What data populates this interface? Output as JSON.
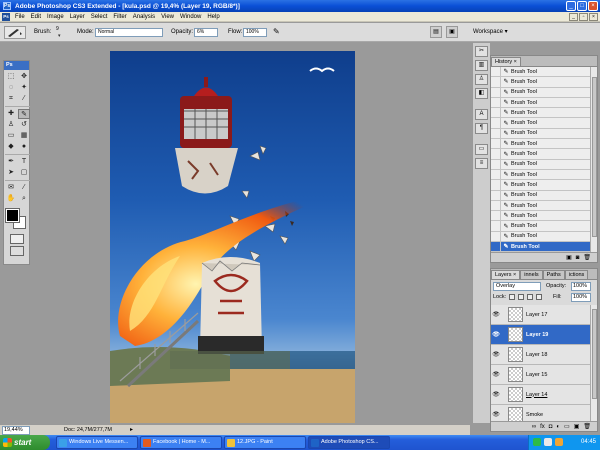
{
  "window": {
    "title": "Adobe Photoshop CS3 Extended - [kula.psd @ 19,4% (Layer 19, RGB/8*)]",
    "app_icon": "Ps"
  },
  "menu": {
    "items": [
      "File",
      "Edit",
      "Image",
      "Layer",
      "Select",
      "Filter",
      "Analysis",
      "View",
      "Window",
      "Help"
    ]
  },
  "options": {
    "brush_label": "Brush:",
    "brush_size": "9",
    "mode_label": "Mode:",
    "mode_value": "Normal",
    "opacity_label": "Opacity:",
    "opacity_value": "6%",
    "flow_label": "Flow:",
    "flow_value": "100%",
    "workspace_label": "Workspace"
  },
  "toolbox": {
    "header": "Ps"
  },
  "status": {
    "zoom": "19,44%",
    "doc": "Doc: 24,7M/277,7M"
  },
  "history": {
    "tabs": [
      "History"
    ],
    "items": [
      "Brush Tool",
      "Brush Tool",
      "Brush Tool",
      "Brush Tool",
      "Brush Tool",
      "Brush Tool",
      "Brush Tool",
      "Brush Tool",
      "Brush Tool",
      "Brush Tool",
      "Brush Tool",
      "Brush Tool",
      "Brush Tool",
      "Brush Tool",
      "Brush Tool",
      "Brush Tool",
      "Brush Tool",
      "Brush Tool"
    ],
    "selected_index": 17
  },
  "layers": {
    "tabs": [
      "Layers",
      "innels",
      "Paths",
      "ictions"
    ],
    "blend_mode": "Overlay",
    "opacity_label": "Opacity:",
    "opacity_value": "100%",
    "lock_label": "Lock:",
    "fill_label": "Fill:",
    "fill_value": "100%",
    "items": [
      {
        "name": "Layer 17"
      },
      {
        "name": "Layer 19"
      },
      {
        "name": "Layer 18"
      },
      {
        "name": "Layer 15"
      },
      {
        "name": "Layer 14"
      },
      {
        "name": "Smoke"
      }
    ],
    "selected_index": 1
  },
  "taskbar": {
    "start_label": "start",
    "items": [
      {
        "label": "Windows Live Messen...",
        "icon_color": "#3aa0e8"
      },
      {
        "label": "Facebook | Home - M...",
        "icon_color": "#e35b1e"
      },
      {
        "label": "12.JPG - Paint",
        "icon_color": "#f0c23a"
      },
      {
        "label": "Adobe Photoshop CS...",
        "icon_color": "#1e63c6"
      }
    ],
    "active_index": 3,
    "clock": "04:45"
  },
  "colors": {
    "titlebar": "#0a4fd6",
    "selection": "#3169c6",
    "panel_bg": "#dadada",
    "canvas_bg": "#9a9a9a"
  }
}
